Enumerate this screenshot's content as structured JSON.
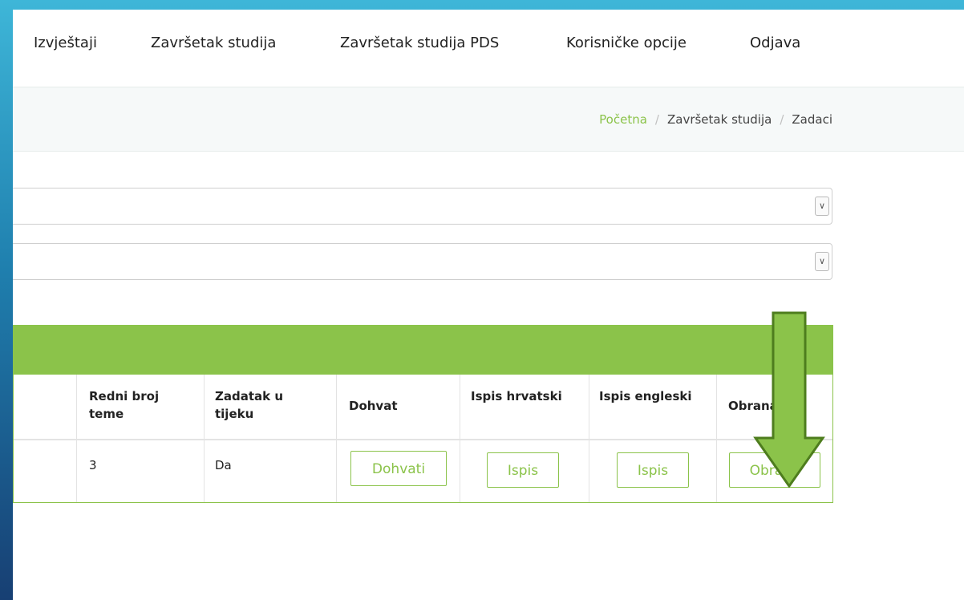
{
  "nav": {
    "items": [
      "Izvještaji",
      "Završetak studija",
      "Završetak studija PDS",
      "Korisničke opcije",
      "Odjava"
    ]
  },
  "breadcrumb": {
    "home": "Početna",
    "sep": "/",
    "section": "Završetak studija",
    "current": "Zadaci"
  },
  "table": {
    "headers": {
      "redni_broj_line1": "Redni broj",
      "redni_broj_line2": "teme",
      "zadatak_line1": "Zadatak u",
      "zadatak_line2": "tijeku",
      "dohvat": "Dohvat",
      "ispis_hr": "Ispis hrvatski",
      "ispis_en": "Ispis engleski",
      "obrana": "Obrana"
    },
    "row": {
      "redni_broj": "3",
      "zadatak_u_tijeku": "Da",
      "dohvat_button": "Dohvati",
      "ispis_hr_button": "Ispis",
      "ispis_en_button": "Ispis",
      "obrana_button": "Obrana"
    }
  },
  "colors": {
    "accent": "#8bc34a",
    "arrow_fill": "#8bc34a",
    "arrow_stroke": "#4e7d1e"
  },
  "annotation": {
    "icon": "down-arrow-icon"
  }
}
